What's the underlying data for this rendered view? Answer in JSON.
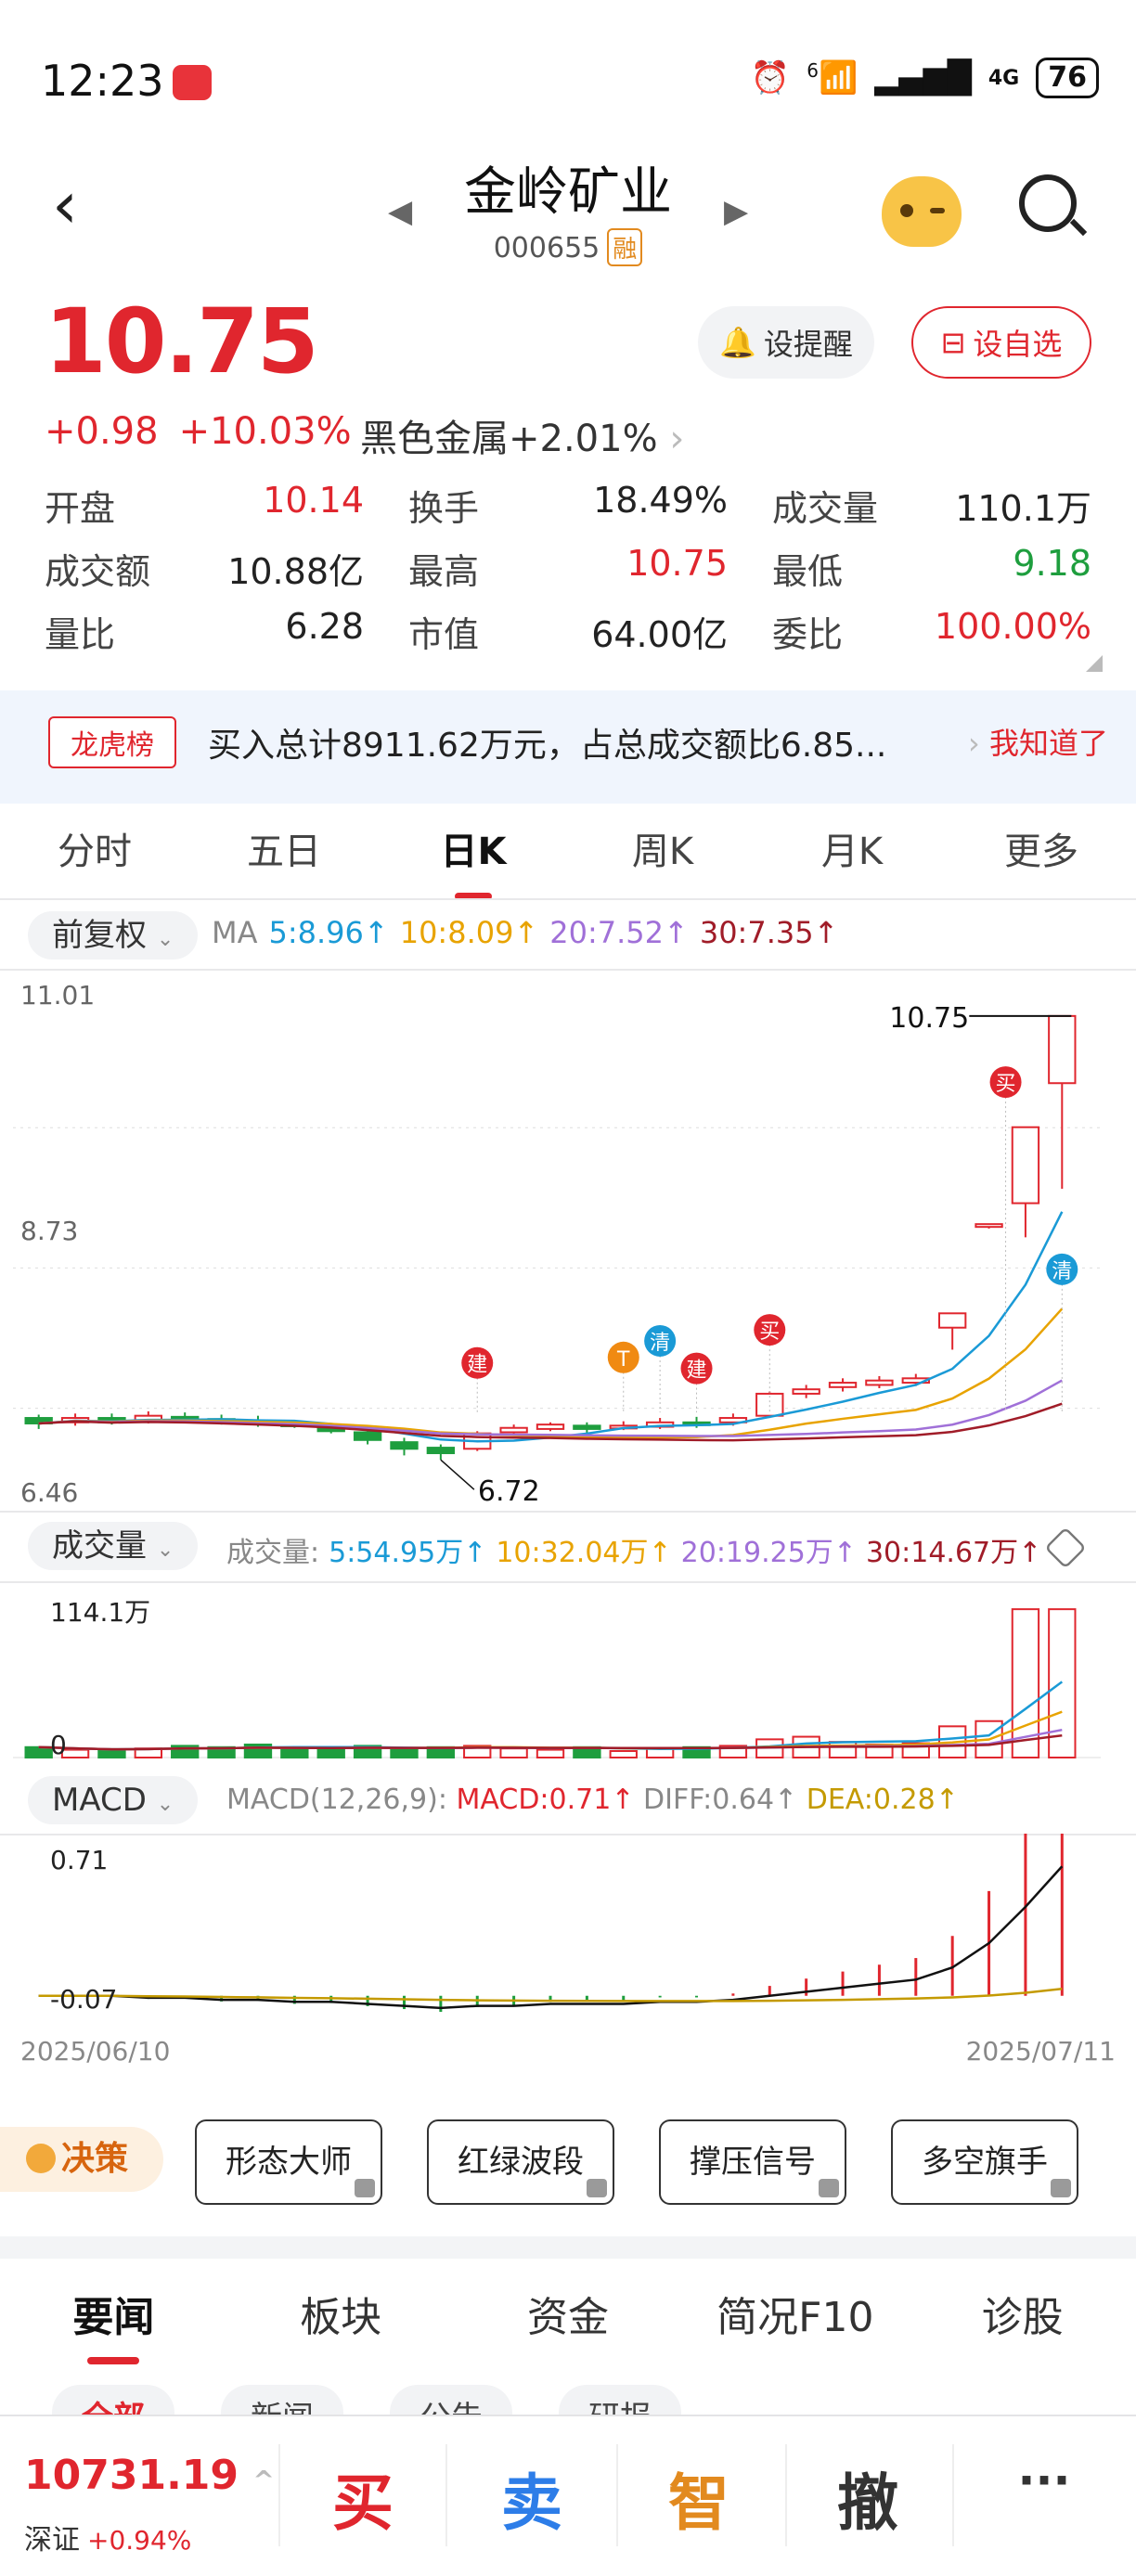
{
  "status_bar": {
    "time": "12:23",
    "network": "4G",
    "signal_prefix": "6",
    "battery": "76"
  },
  "header": {
    "stock_name": "金岭矿业",
    "stock_code": "000655",
    "margin_tag": "融"
  },
  "quote": {
    "price": "10.75",
    "change": "+0.98",
    "change_pct": "+10.03%",
    "sector_name": "黑色金属",
    "sector_change": "+2.01%",
    "remind_label": "设提醒",
    "add_fav_label": "设自选",
    "rows": [
      [
        {
          "label": "开盘",
          "value": "10.14",
          "color": "red"
        },
        {
          "label": "换手",
          "value": "18.49%",
          "color": "black"
        },
        {
          "label": "成交量",
          "value": "110.1万",
          "color": "black"
        }
      ],
      [
        {
          "label": "成交额",
          "value": "10.88亿",
          "color": "black"
        },
        {
          "label": "最高",
          "value": "10.75",
          "color": "red"
        },
        {
          "label": "最低",
          "value": "9.18",
          "color": "green"
        }
      ],
      [
        {
          "label": "量比",
          "value": "6.28",
          "color": "black"
        },
        {
          "label": "市值",
          "value": "64.00亿",
          "color": "black"
        },
        {
          "label": "委比",
          "value": "100.00%",
          "color": "red"
        }
      ]
    ]
  },
  "banner": {
    "tag": "龙虎榜",
    "text": "买入总计8911.62万元，占总成交额比6.85...",
    "action": "我知道了"
  },
  "kline_tabs": [
    "分时",
    "五日",
    "日K",
    "周K",
    "月K",
    "更多"
  ],
  "kline_active": "日K",
  "kline": {
    "adjust_label": "前复权",
    "ma_prefix": "MA",
    "ma": [
      {
        "label": "5:8.96↑",
        "color": "#1a9ad6"
      },
      {
        "label": "10:8.09↑",
        "color": "#e8a300"
      },
      {
        "label": "20:7.52↑",
        "color": "#a070d8"
      },
      {
        "label": "30:7.35↑",
        "color": "#a01c28"
      }
    ],
    "y_high": "11.01",
    "y_mid": "8.73",
    "y_low": "6.46",
    "max_label": "10.75",
    "min_label": "6.72",
    "markers": [
      {
        "label": "建",
        "type": "jian"
      },
      {
        "label": "T",
        "type": "t"
      },
      {
        "label": "清",
        "type": "qing"
      },
      {
        "label": "建",
        "type": "jian"
      },
      {
        "label": "买",
        "type": "mai"
      },
      {
        "label": "买",
        "type": "mai"
      },
      {
        "label": "清",
        "type": "qing"
      }
    ]
  },
  "volume": {
    "selector_label": "成交量",
    "title": "成交量:",
    "ma": [
      {
        "label": "5:54.95万↑",
        "color": "#1a9ad6"
      },
      {
        "label": "10:32.04万↑",
        "color": "#e8a300"
      },
      {
        "label": "20:19.25万↑",
        "color": "#a070d8"
      },
      {
        "label": "30:14.67万↑",
        "color": "#a01c28"
      }
    ],
    "y_max": "114.1万",
    "y_zero": "0"
  },
  "macd": {
    "selector_label": "MACD",
    "title": "MACD(12,26,9):",
    "macd_value": "MACD:0.71↑",
    "diff_value": "DIFF:0.64↑",
    "dea_value": "DEA:0.28↑",
    "y_max": "0.71",
    "y_min": "-0.07",
    "date_start": "2025/06/10",
    "date_end": "2025/07/11"
  },
  "chart_data": {
    "type": "candlestick",
    "x_range": [
      "2025/06/10",
      "2025/07/11"
    ],
    "ylim": [
      6.46,
      11.01
    ],
    "candles": [
      {
        "o": 7.1,
        "c": 7.05,
        "h": 7.13,
        "l": 7.0
      },
      {
        "o": 7.06,
        "c": 7.1,
        "h": 7.14,
        "l": 7.03
      },
      {
        "o": 7.1,
        "c": 7.06,
        "h": 7.14,
        "l": 7.04
      },
      {
        "o": 7.08,
        "c": 7.12,
        "h": 7.16,
        "l": 7.05
      },
      {
        "o": 7.11,
        "c": 7.09,
        "h": 7.15,
        "l": 7.06
      },
      {
        "o": 7.09,
        "c": 7.07,
        "h": 7.13,
        "l": 7.04
      },
      {
        "o": 7.07,
        "c": 7.05,
        "h": 7.12,
        "l": 7.02
      },
      {
        "o": 7.05,
        "c": 7.04,
        "h": 7.08,
        "l": 7.01
      },
      {
        "o": 7.03,
        "c": 6.98,
        "h": 7.05,
        "l": 6.96
      },
      {
        "o": 6.97,
        "c": 6.9,
        "h": 6.99,
        "l": 6.86
      },
      {
        "o": 6.88,
        "c": 6.82,
        "h": 6.92,
        "l": 6.76
      },
      {
        "o": 6.83,
        "c": 6.78,
        "h": 6.86,
        "l": 6.72
      },
      {
        "o": 6.82,
        "c": 6.96,
        "h": 6.98,
        "l": 6.8
      },
      {
        "o": 6.97,
        "c": 7.01,
        "h": 7.04,
        "l": 6.94
      },
      {
        "o": 7.0,
        "c": 7.04,
        "h": 7.06,
        "l": 6.98
      },
      {
        "o": 7.03,
        "c": 7.0,
        "h": 7.06,
        "l": 6.96
      },
      {
        "o": 7.01,
        "c": 7.03,
        "h": 7.07,
        "l": 6.99
      },
      {
        "o": 7.02,
        "c": 7.06,
        "h": 7.1,
        "l": 7.0
      },
      {
        "o": 7.06,
        "c": 7.04,
        "h": 7.11,
        "l": 7.01
      },
      {
        "o": 7.06,
        "c": 7.1,
        "h": 7.14,
        "l": 7.03
      },
      {
        "o": 7.12,
        "c": 7.32,
        "h": 7.34,
        "l": 7.1
      },
      {
        "o": 7.32,
        "c": 7.36,
        "h": 7.4,
        "l": 7.28
      },
      {
        "o": 7.38,
        "c": 7.42,
        "h": 7.46,
        "l": 7.34
      },
      {
        "o": 7.4,
        "c": 7.44,
        "h": 7.48,
        "l": 7.37
      },
      {
        "o": 7.42,
        "c": 7.46,
        "h": 7.5,
        "l": 7.39
      },
      {
        "o": 7.92,
        "c": 8.05,
        "h": 8.05,
        "l": 7.72
      },
      {
        "o": 8.86,
        "c": 8.86,
        "h": 8.86,
        "l": 8.82
      },
      {
        "o": 9.05,
        "c": 9.74,
        "h": 9.74,
        "l": 8.74
      },
      {
        "o": 10.14,
        "c": 10.75,
        "h": 10.75,
        "l": 9.18
      }
    ],
    "volume_ylim": [
      0,
      114.1
    ],
    "macd_ylim": [
      -0.07,
      0.71
    ]
  },
  "tools": {
    "juece": "决策",
    "buttons": [
      "形态大师",
      "红绿波段",
      "撑压信号",
      "多空旗手"
    ]
  },
  "news_tabs": [
    "要闻",
    "板块",
    "资金",
    "简况F10",
    "诊股"
  ],
  "news_active": "要闻",
  "news_subtabs": [
    "全部",
    "新闻",
    "公告",
    "研报"
  ],
  "bottom_bar": {
    "index_value": "10731.19",
    "index_name": "深证",
    "index_change": "+0.94%",
    "buy": "买",
    "sell": "卖",
    "smart": "智",
    "cancel": "撤",
    "more": "···"
  }
}
